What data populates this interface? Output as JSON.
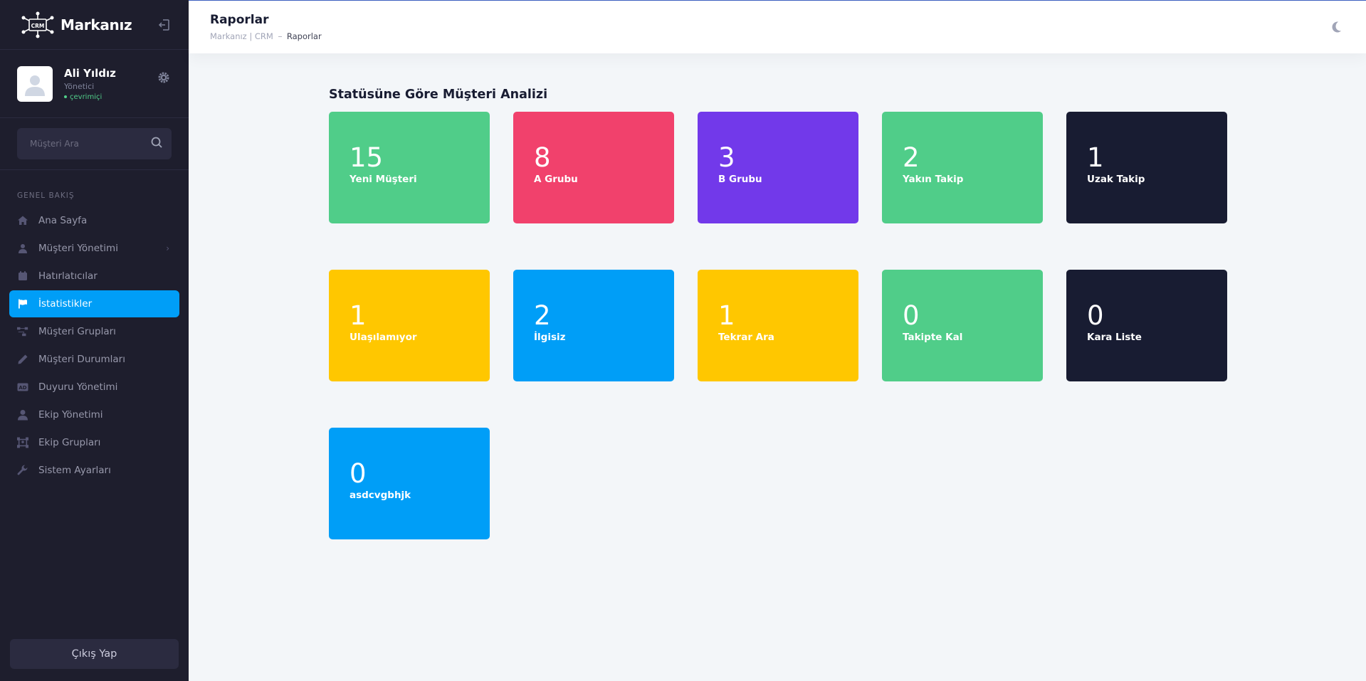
{
  "brand": {
    "name": "Markanız",
    "logo_text": "CRM"
  },
  "user": {
    "name": "Ali Yıldız",
    "role": "Yönetici",
    "status": "çevrimiçi"
  },
  "search": {
    "placeholder": "Müşteri Ara"
  },
  "menu": {
    "section_label": "GENEL BAKIŞ",
    "items": [
      {
        "label": "Ana Sayfa",
        "icon": "home-icon"
      },
      {
        "label": "Müşteri Yönetimi",
        "icon": "user-icon",
        "has_submenu": true
      },
      {
        "label": "Hatırlatıcılar",
        "icon": "calendar-icon"
      },
      {
        "label": "İstatistikler",
        "icon": "flag-icon",
        "active": true
      },
      {
        "label": "Müşteri Grupları",
        "icon": "hierarchy-icon"
      },
      {
        "label": "Müşteri Durumları",
        "icon": "pencil-icon"
      },
      {
        "label": "Duyuru Yönetimi",
        "icon": "ad-icon"
      },
      {
        "label": "Ekip Yönetimi",
        "icon": "person-icon"
      },
      {
        "label": "Ekip Grupları",
        "icon": "group-frame-icon"
      },
      {
        "label": "Sistem Ayarları",
        "icon": "wrench-icon"
      }
    ]
  },
  "logout": {
    "label": "Çıkış Yap"
  },
  "header": {
    "title": "Raporlar",
    "breadcrumb": [
      "Markanız | CRM",
      "Raporlar"
    ]
  },
  "main": {
    "section_title": "Statüsüne Göre Müşteri Analizi",
    "cards": [
      {
        "count": "15",
        "label": "Yeni Müşteri",
        "color": "#50cd89"
      },
      {
        "count": "8",
        "label": "A Grubu",
        "color": "#f1416c"
      },
      {
        "count": "3",
        "label": "B Grubu",
        "color": "#7239ea"
      },
      {
        "count": "2",
        "label": "Yakın Takip",
        "color": "#50cd89"
      },
      {
        "count": "1",
        "label": "Uzak Takip",
        "color": "#181c32"
      },
      {
        "count": "1",
        "label": "Ulaşılamıyor",
        "color": "#ffc700"
      },
      {
        "count": "2",
        "label": "İlgisiz",
        "color": "#009ef7"
      },
      {
        "count": "1",
        "label": "Tekrar Ara",
        "color": "#ffc700"
      },
      {
        "count": "0",
        "label": "Takipte Kal",
        "color": "#50cd89"
      },
      {
        "count": "0",
        "label": "Kara Liste",
        "color": "#181c32"
      },
      {
        "count": "0",
        "label": "asdcvgbhjk",
        "color": "#009ef7"
      }
    ]
  }
}
